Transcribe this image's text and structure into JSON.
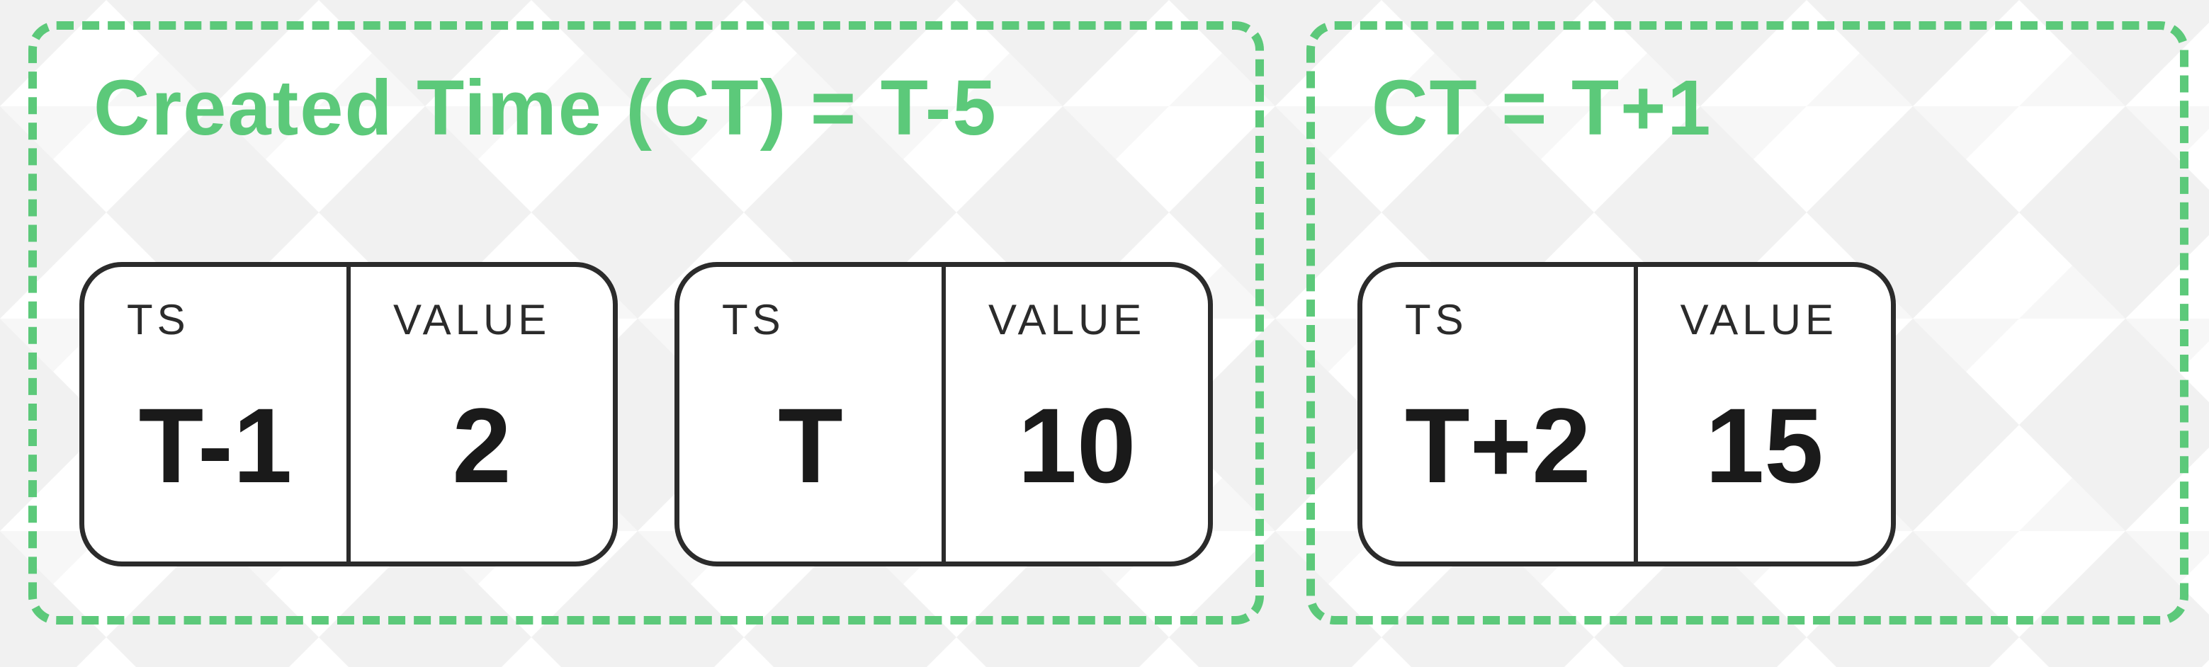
{
  "colors": {
    "accent": "#5cc97a",
    "ink": "#2b2b2b"
  },
  "labels": {
    "ts": "TS",
    "value": "VALUE"
  },
  "groups": [
    {
      "title": "Created Time (CT) = T-5",
      "cards": [
        {
          "ts": "T-1",
          "value": "2"
        },
        {
          "ts": "T",
          "value": "10"
        }
      ]
    },
    {
      "title": "CT = T+1",
      "cards": [
        {
          "ts": "T+2",
          "value": "15"
        }
      ]
    }
  ]
}
